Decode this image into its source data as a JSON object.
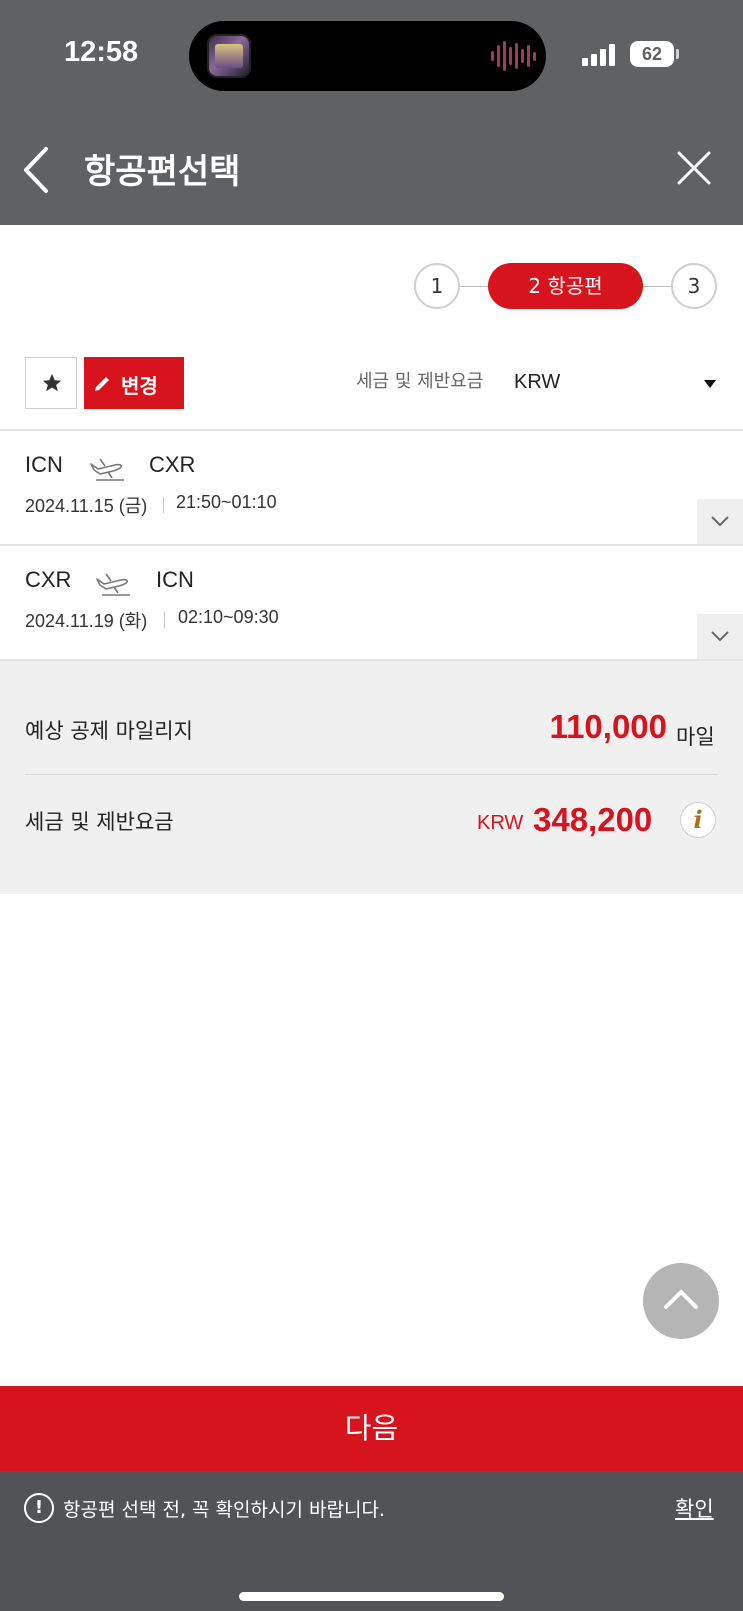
{
  "status": {
    "time": "12:58",
    "battery": "62"
  },
  "header": {
    "title": "항공편선택"
  },
  "steps": {
    "step1": "1",
    "step2": "2  항공편",
    "step3": "3"
  },
  "toolbar": {
    "edit_label": "변경",
    "tax_label": "세금 및 제반요금",
    "currency": "KRW"
  },
  "flights": [
    {
      "from": "ICN",
      "to": "CXR",
      "date": "2024.11.15 (금)",
      "time": "21:50~01:10"
    },
    {
      "from": "CXR",
      "to": "ICN",
      "date": "2024.11.19 (화)",
      "time": "02:10~09:30"
    }
  ],
  "summary": {
    "miles_label": "예상 공제 마일리지",
    "miles_value": "110,000",
    "miles_unit": "마일",
    "tax_label": "세금 및 제반요금",
    "tax_currency": "KRW",
    "tax_value": "348,200"
  },
  "next_label": "다음",
  "notice": {
    "text": "항공편 선택 전, 꼭 확인하시기 바랍니다.",
    "confirm": "확인"
  },
  "colors": {
    "accent": "#d7131e",
    "header": "#5f6163",
    "notice": "#515356",
    "info": "#a6731f"
  },
  "icons": [
    "back-chevron-icon",
    "close-icon",
    "star-icon",
    "pencil-icon",
    "caret-down-icon",
    "plane-icon",
    "chevron-down-icon",
    "info-icon",
    "chevron-up-icon",
    "alert-icon"
  ]
}
